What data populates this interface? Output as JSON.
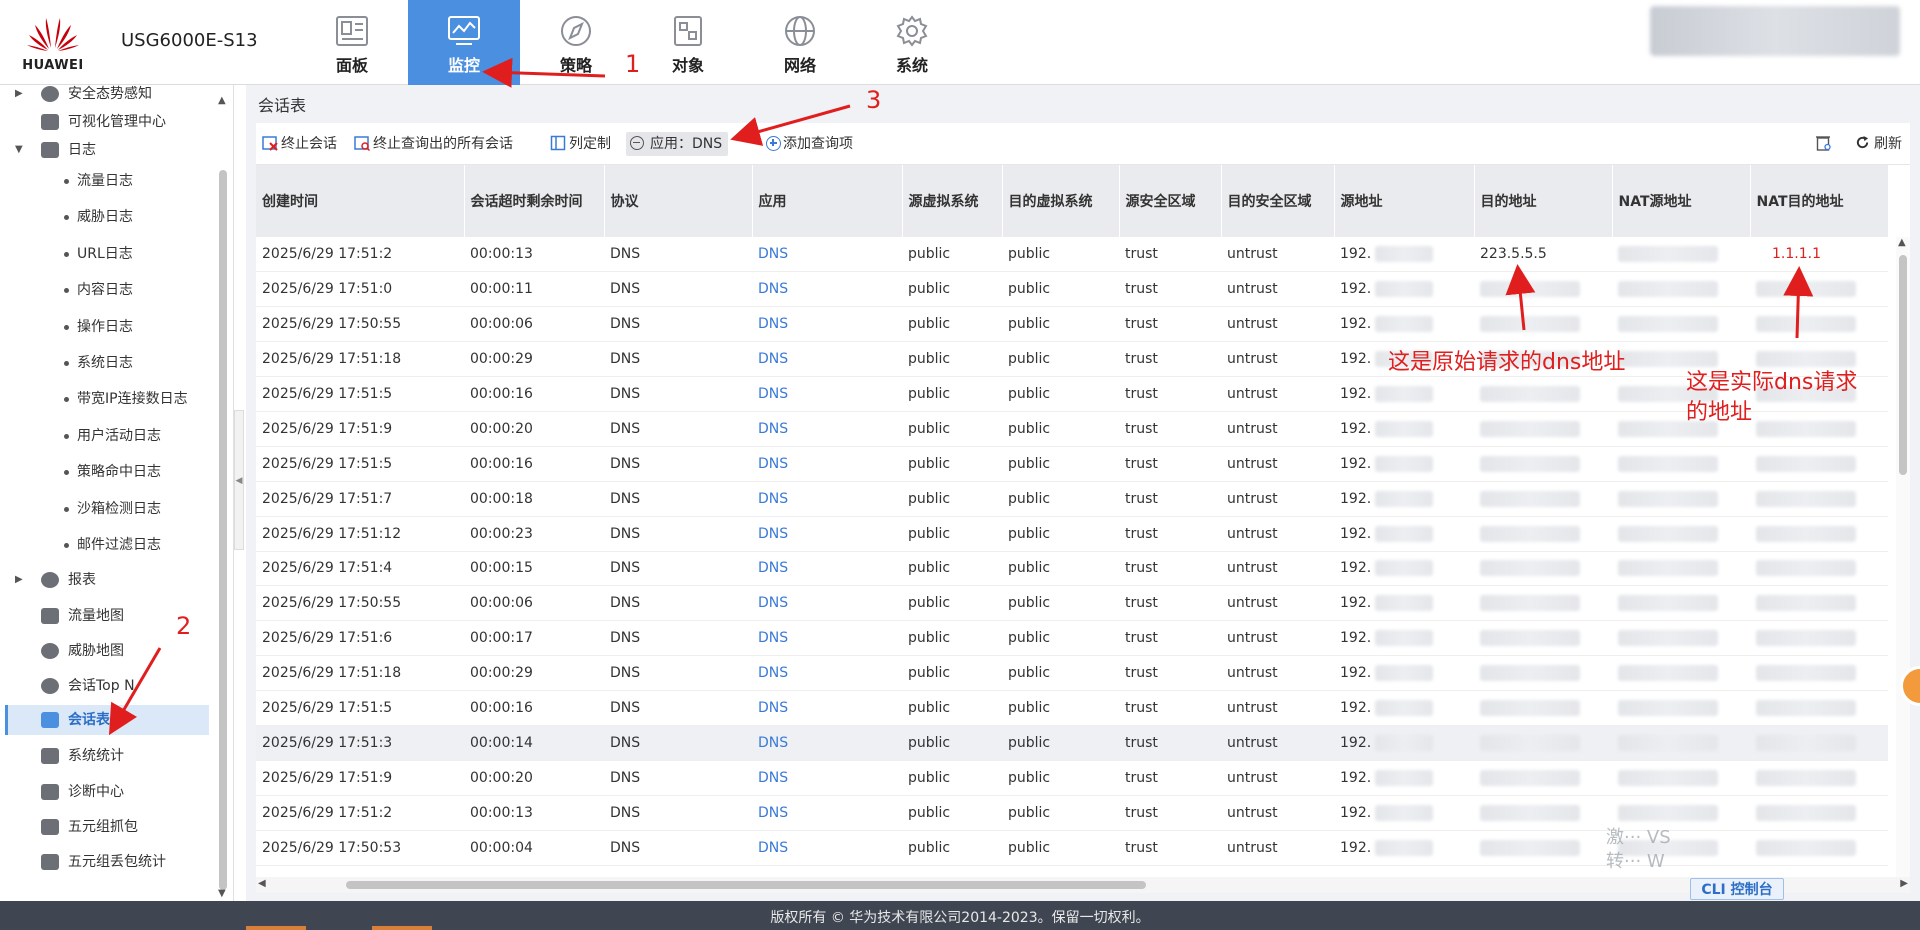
{
  "header": {
    "brand": "HUAWEI",
    "device": "USG6000E-S13",
    "nav": [
      {
        "label": "面板",
        "icon": "dashboard-icon"
      },
      {
        "label": "监控",
        "icon": "monitor-icon",
        "active": true
      },
      {
        "label": "策略",
        "icon": "compass-icon"
      },
      {
        "label": "对象",
        "icon": "object-icon"
      },
      {
        "label": "网络",
        "icon": "globe-icon"
      },
      {
        "label": "系统",
        "icon": "gear-icon"
      }
    ]
  },
  "sidebar": {
    "items": [
      {
        "label": "安全态势感知",
        "icon": "shield-icon"
      },
      {
        "label": "可视化管理中心",
        "icon": "dashboard-icon"
      },
      {
        "label": "日志",
        "icon": "log-icon"
      },
      {
        "label": "流量日志"
      },
      {
        "label": "威胁日志"
      },
      {
        "label": "URL日志"
      },
      {
        "label": "内容日志"
      },
      {
        "label": "操作日志"
      },
      {
        "label": "系统日志"
      },
      {
        "label": "带宽IP连接数日志"
      },
      {
        "label": "用户活动日志"
      },
      {
        "label": "策略命中日志"
      },
      {
        "label": "沙箱检测日志"
      },
      {
        "label": "邮件过滤日志"
      },
      {
        "label": "报表",
        "icon": "report-icon"
      },
      {
        "label": "流量地图",
        "icon": "map-icon"
      },
      {
        "label": "威胁地图",
        "icon": "threat-map-icon"
      },
      {
        "label": "会话Top N",
        "icon": "top-n-icon"
      },
      {
        "label": "会话表",
        "icon": "session-table-icon",
        "selected": true
      },
      {
        "label": "系统统计",
        "icon": "stats-icon"
      },
      {
        "label": "诊断中心",
        "icon": "diagnose-icon"
      },
      {
        "label": "五元组抓包",
        "icon": "capture-icon"
      },
      {
        "label": "五元组丢包统计",
        "icon": "drop-stats-icon"
      }
    ]
  },
  "main": {
    "title": "会话表",
    "toolbar": {
      "terminate": "终止会话",
      "terminate_all": "终止查询出的所有会话",
      "columns": "列定制",
      "filter": "应用：DNS",
      "add_query": "添加查询项",
      "refresh": "刷新"
    },
    "table": {
      "columns": [
        "创建时间",
        "会话超时剩余时间",
        "协议",
        "应用",
        "源虚拟系统",
        "目的虚拟系统",
        "源安全区域",
        "目的安全区域",
        "源地址",
        "目的地址",
        "NAT源地址",
        "NAT目的地址"
      ],
      "rows": [
        [
          "2025/6/29 17:51:2",
          "00:00:13",
          "DNS",
          "DNS",
          "public",
          "public",
          "trust",
          "untrust",
          "192.",
          "223.5.5.5",
          "",
          "1.1.1.1"
        ],
        [
          "2025/6/29 17:51:0",
          "00:00:11",
          "DNS",
          "DNS",
          "public",
          "public",
          "trust",
          "untrust",
          "192.",
          "",
          "",
          ""
        ],
        [
          "2025/6/29 17:50:55",
          "00:00:06",
          "DNS",
          "DNS",
          "public",
          "public",
          "trust",
          "untrust",
          "192.",
          "",
          "",
          ""
        ],
        [
          "2025/6/29 17:51:18",
          "00:00:29",
          "DNS",
          "DNS",
          "public",
          "public",
          "trust",
          "untrust",
          "192.",
          "",
          "",
          ""
        ],
        [
          "2025/6/29 17:51:5",
          "00:00:16",
          "DNS",
          "DNS",
          "public",
          "public",
          "trust",
          "untrust",
          "192.",
          "",
          "",
          ""
        ],
        [
          "2025/6/29 17:51:9",
          "00:00:20",
          "DNS",
          "DNS",
          "public",
          "public",
          "trust",
          "untrust",
          "192.",
          "",
          "",
          ""
        ],
        [
          "2025/6/29 17:51:5",
          "00:00:16",
          "DNS",
          "DNS",
          "public",
          "public",
          "trust",
          "untrust",
          "192.",
          "",
          "",
          ""
        ],
        [
          "2025/6/29 17:51:7",
          "00:00:18",
          "DNS",
          "DNS",
          "public",
          "public",
          "trust",
          "untrust",
          "192.",
          "",
          "",
          ""
        ],
        [
          "2025/6/29 17:51:12",
          "00:00:23",
          "DNS",
          "DNS",
          "public",
          "public",
          "trust",
          "untrust",
          "192.",
          "",
          "",
          ""
        ],
        [
          "2025/6/29 17:51:4",
          "00:00:15",
          "DNS",
          "DNS",
          "public",
          "public",
          "trust",
          "untrust",
          "192.",
          "",
          "",
          ""
        ],
        [
          "2025/6/29 17:50:55",
          "00:00:06",
          "DNS",
          "DNS",
          "public",
          "public",
          "trust",
          "untrust",
          "192.",
          "",
          "",
          ""
        ],
        [
          "2025/6/29 17:51:6",
          "00:00:17",
          "DNS",
          "DNS",
          "public",
          "public",
          "trust",
          "untrust",
          "192.",
          "",
          "",
          ""
        ],
        [
          "2025/6/29 17:51:18",
          "00:00:29",
          "DNS",
          "DNS",
          "public",
          "public",
          "trust",
          "untrust",
          "192.",
          "",
          "",
          ""
        ],
        [
          "2025/6/29 17:51:5",
          "00:00:16",
          "DNS",
          "DNS",
          "public",
          "public",
          "trust",
          "untrust",
          "192.",
          "",
          "",
          ""
        ],
        [
          "2025/6/29 17:51:3",
          "00:00:14",
          "DNS",
          "DNS",
          "public",
          "public",
          "trust",
          "untrust",
          "192.",
          "",
          "",
          ""
        ],
        [
          "2025/6/29 17:51:9",
          "00:00:20",
          "DNS",
          "DNS",
          "public",
          "public",
          "trust",
          "untrust",
          "192.",
          "",
          "",
          ""
        ],
        [
          "2025/6/29 17:51:2",
          "00:00:13",
          "DNS",
          "DNS",
          "public",
          "public",
          "trust",
          "untrust",
          "192.",
          "",
          "",
          ""
        ],
        [
          "2025/6/29 17:50:53",
          "00:00:04",
          "DNS",
          "DNS",
          "public",
          "public",
          "trust",
          "untrust",
          "192.",
          "",
          "",
          ""
        ]
      ]
    },
    "cli": "CLI 控制台"
  },
  "annotations": {
    "n1": "1",
    "n2": "2",
    "n3": "3",
    "orig_dns": "这是原始请求的dns地址",
    "actual_dns_line1": "这是实际dns请求",
    "actual_dns_line2": "的地址",
    "color": "#e01e1e"
  },
  "footer": {
    "copyright": "版权所有 © 华为技术有限公司2014-2023。保留一切权利。"
  },
  "colors": {
    "accent": "#4a8fe0",
    "link": "#3a7ad6",
    "brand_red": "#c7000b",
    "footer_bg": "#3f4652"
  }
}
